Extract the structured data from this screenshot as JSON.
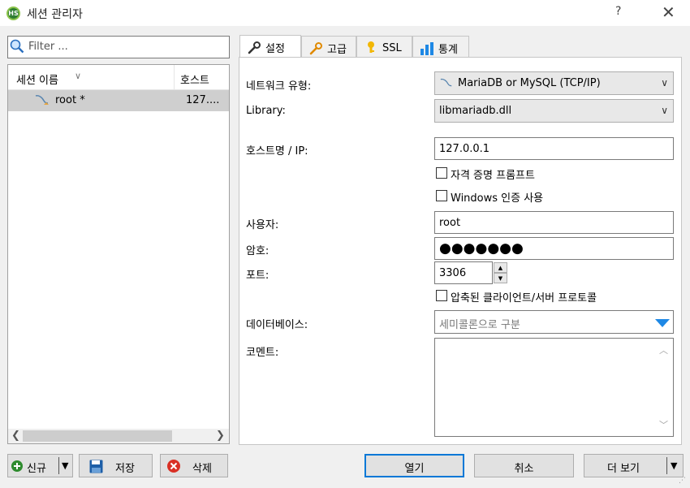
{
  "window": {
    "title": "세션 관리자",
    "help": "?",
    "close": "✕",
    "app_icon_text": "HS"
  },
  "filter": {
    "placeholder": "Filter ..."
  },
  "session_list": {
    "col_name": "세션 이름",
    "col_host": "호스트",
    "rows": [
      {
        "name": "root *",
        "host": "127...."
      }
    ]
  },
  "tabs": [
    {
      "label": "설정",
      "icon": "wrench-icon",
      "active": true
    },
    {
      "label": "고급",
      "icon": "wrench-icon"
    },
    {
      "label": "SSL",
      "icon": "key-icon"
    },
    {
      "label": "통계",
      "icon": "bar-chart-icon"
    }
  ],
  "settings": {
    "network_type_label": "네트워크 유형:",
    "network_type_value": "MariaDB or MySQL (TCP/IP)",
    "library_label": "Library:",
    "library_value": "libmariadb.dll",
    "host_label": "호스트명 / IP:",
    "host_value": "127.0.0.1",
    "prompt_cred_label": "자격 증명 프롬프트",
    "windows_auth_label": "Windows 인증 사용",
    "user_label": "사용자:",
    "user_value": "root",
    "password_label": "암호:",
    "password_value": "●●●●●●●",
    "port_label": "포트:",
    "port_value": "3306",
    "compress_label": "압축된 클라이언트/서버 프로토콜",
    "database_label": "데이터베이스:",
    "database_placeholder": "세미콜론으로 구분",
    "comment_label": "코멘트:"
  },
  "buttons": {
    "new": "신규",
    "save": "저장",
    "delete": "삭제",
    "open": "열기",
    "cancel": "취소",
    "more": "더 보기"
  }
}
